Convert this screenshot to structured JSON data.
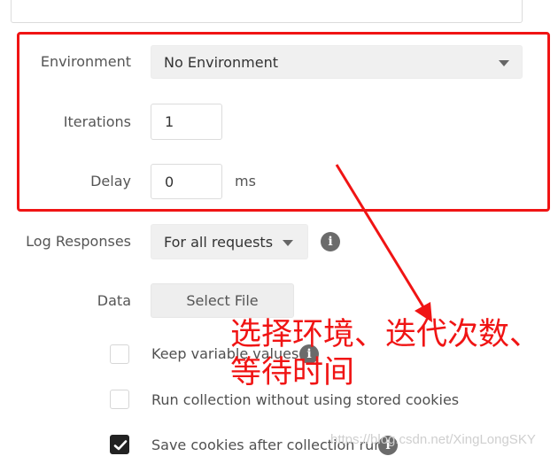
{
  "form": {
    "environment": {
      "label": "Environment",
      "value": "No Environment"
    },
    "iterations": {
      "label": "Iterations",
      "value": "1"
    },
    "delay": {
      "label": "Delay",
      "value": "0",
      "unit": "ms"
    },
    "log_responses": {
      "label": "Log Responses",
      "value": "For all requests"
    },
    "data": {
      "label": "Data",
      "button": "Select File"
    },
    "options": [
      {
        "label": "Keep variable values",
        "checked": false
      },
      {
        "label": "Run collection without using stored cookies",
        "checked": false
      },
      {
        "label": "Save cookies after collection run",
        "checked": true
      }
    ]
  },
  "annotation": {
    "line1": "选择环境、迭代次数、",
    "line2": "等待时间",
    "color": "#f01414"
  },
  "watermark": "https://blog.csdn.net/XingLongSKY",
  "icons": {
    "info": "i",
    "dropdown": "caret-down-icon",
    "check": "checkmark-icon"
  }
}
